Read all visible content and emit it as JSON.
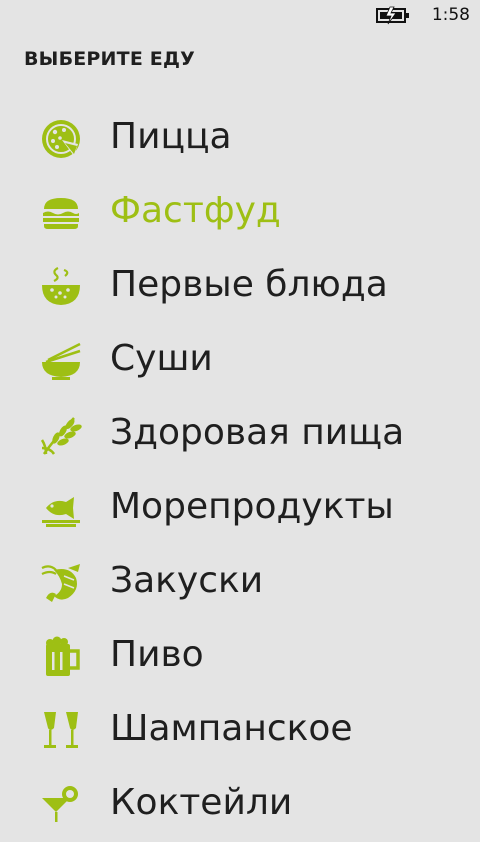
{
  "status_bar": {
    "time": "1:58",
    "battery_icon": "battery-charging-icon"
  },
  "page": {
    "title": "ВЫБЕРИТЕ ЕДУ"
  },
  "colors": {
    "accent": "#9ebf14",
    "background": "#e4e4e4",
    "text": "#1f1f1f"
  },
  "menu": {
    "selected_index": 1,
    "items": [
      {
        "label": "Пицца",
        "icon": "pizza-icon"
      },
      {
        "label": "Фастфуд",
        "icon": "burger-icon"
      },
      {
        "label": "Первые блюда",
        "icon": "soup-bowl-icon"
      },
      {
        "label": "Суши",
        "icon": "chopsticks-bowl-icon"
      },
      {
        "label": "Здоровая пища",
        "icon": "wheat-icon"
      },
      {
        "label": "Морепродукты",
        "icon": "fish-plate-icon"
      },
      {
        "label": "Закуски",
        "icon": "crayfish-icon"
      },
      {
        "label": "Пиво",
        "icon": "beer-mug-icon"
      },
      {
        "label": "Шампанское",
        "icon": "champagne-glasses-icon"
      },
      {
        "label": "Коктейли",
        "icon": "cocktail-icon"
      }
    ]
  }
}
